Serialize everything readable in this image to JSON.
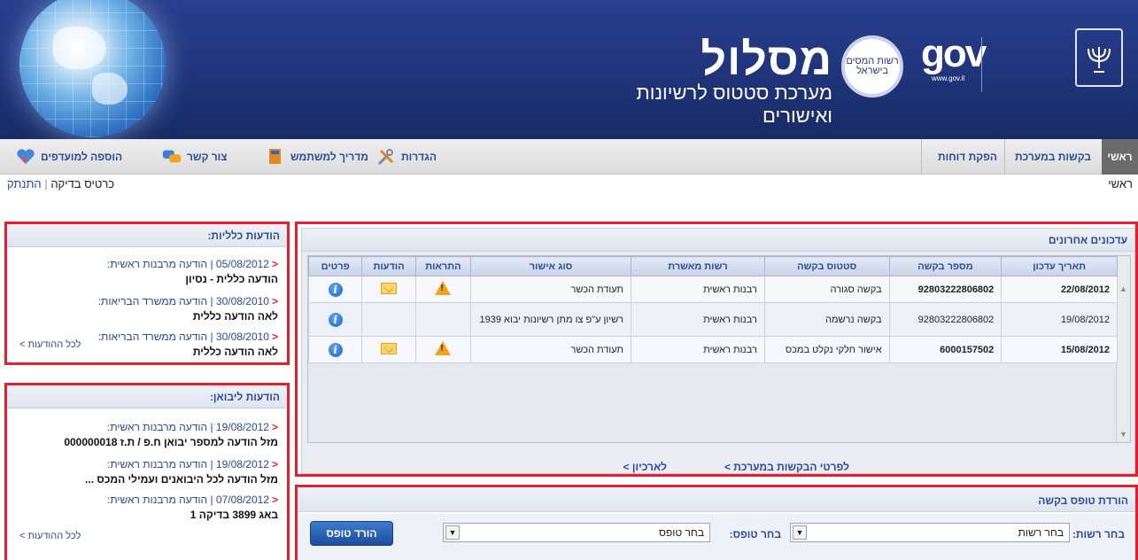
{
  "header": {
    "app_name": "מסלול",
    "app_subtitle": "מערכת סטטוס לרשיונות ואישורים",
    "authority_logo_text": "רשות המסים בישראל",
    "gov_logo": "gov",
    "gov_url": "www.gov.il",
    "emblem_icon": "menorah-emblem-icon",
    "globe_image": "globe-icon"
  },
  "nav": {
    "home": "ראשי",
    "requests": "בקשות במערכת",
    "reports": "הפקת דוחות",
    "settings": "הגדרות",
    "guide": "מדריך למשתמש",
    "contact": "צור קשר",
    "favorites": "הוספה למועדפים"
  },
  "subbar": {
    "breadcrumb": "ראשי",
    "user": "כרטיס בדיקה",
    "logout": "התנתק"
  },
  "updates": {
    "title": "עדכונים אחרונים",
    "columns": [
      "תאריך עדכון",
      "מספר בקשה",
      "סטטוס בקשה",
      "רשות מאשרת",
      "סוג אישור",
      "התראות",
      "הודעות",
      "פרטים"
    ],
    "rows": [
      {
        "date": "22/08/2012",
        "request_no": "92803222806802",
        "status": "בקשה סגורה",
        "authority": "רבנות ראשית",
        "approval_type": "תעודת הכשר",
        "alert": true,
        "message": true
      },
      {
        "date": "19/08/2012",
        "request_no": "92803222806802",
        "status": "בקשה נרשמה",
        "authority": "רבנות ראשית",
        "approval_type": "רשיון ע\"פ צו מתן רשיונות יבוא 1939",
        "alert": false,
        "message": false
      },
      {
        "date": "15/08/2012",
        "request_no": "6000157502",
        "status": "אישור חלקי נקלט במכס",
        "authority": "רבנות ראשית",
        "approval_type": "תעודת הכשר",
        "alert": true,
        "message": true
      }
    ],
    "link_details": "לפרטי הבקשות במערכת >",
    "link_archive": "לארכיון >"
  },
  "form_download": {
    "title": "הורדת טופס בקשה",
    "authority_label": "בחר רשות:",
    "authority_value": "בחר רשות",
    "form_label": "בחר טופס:",
    "form_value": "בחר טופס",
    "button": "הורד טופס"
  },
  "general_messages": {
    "title": "הודעות כלליות:",
    "items": [
      {
        "meta": "05/08/2012 | הודעה מרבנות ראשית:",
        "text": "הודעה כללית - נסיון"
      },
      {
        "meta": "30/08/2010 | הודעה ממשרד הבריאות:",
        "text": "לאה הודעה כללית"
      },
      {
        "meta": "30/08/2010 | הודעה ממשרד הבריאות:",
        "text": "לאה הודעה כללית"
      }
    ],
    "all_link": "לכל ההודעות >"
  },
  "importer_messages": {
    "title": "הודעות ליבואן:",
    "items": [
      {
        "meta": "19/08/2012 | הודעה מרבנות ראשית:",
        "text": "מזל הודעה למספר יבואן ח.פ / ת.ז 000000018"
      },
      {
        "meta": "19/08/2012 | הודעה מרבנות ראשית:",
        "text": "מזל הודעה לכל היבואנים ועמילי המכס ..."
      },
      {
        "meta": "07/08/2012 | הודעה מרבנות ראשית:",
        "text": "באג 3899 בדיקה 1"
      }
    ],
    "all_link": "לכל ההודעות >"
  },
  "colors": {
    "header_blue": "#1f3479",
    "link_blue": "#2b4a9a",
    "highlight_red": "#e5202e"
  }
}
